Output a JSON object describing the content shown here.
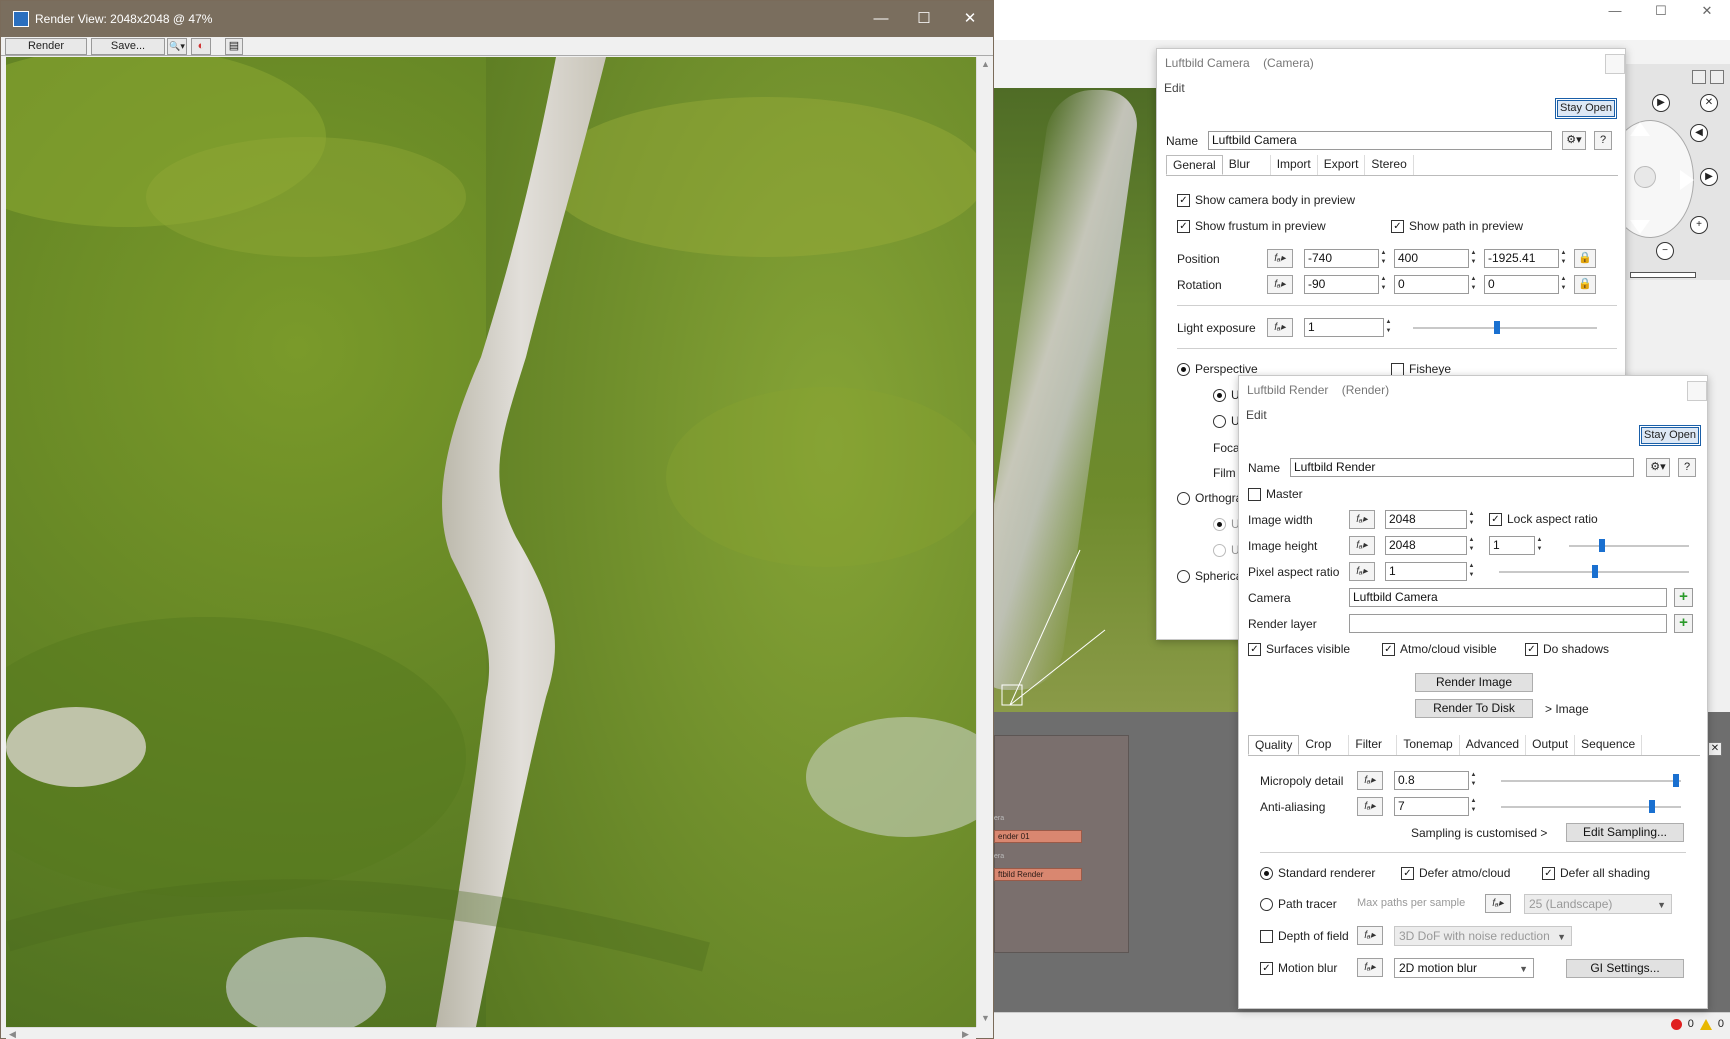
{
  "render_view": {
    "title": "Render View: 2048x2048 @ 47%",
    "toolbar": {
      "render_label": "Render",
      "save_label": "Save...",
      "zoom_glyph": "🔍▾",
      "color_glyph": "◐",
      "doc_glyph": "▤"
    }
  },
  "window_controls": {
    "minimize": "—",
    "maximize": "☐",
    "close": "✕"
  },
  "camera_dialog": {
    "title": "Luftbild Camera",
    "type": "(Camera)",
    "menu_edit": "Edit",
    "stay_open": "Stay Open",
    "name_label": "Name",
    "name_value": "Luftbild Camera",
    "help": "?",
    "tabs": [
      "General",
      "Blur",
      "Import",
      "Export",
      "Stereo"
    ],
    "show_body": "Show camera body in preview",
    "show_frustum": "Show frustum in preview",
    "show_path": "Show path in preview",
    "position_label": "Position",
    "position": [
      "-740",
      "400",
      "-1925.41"
    ],
    "rotation_label": "Rotation",
    "rotation": [
      "-90",
      "0",
      "0"
    ],
    "light_exposure_label": "Light exposure",
    "light_exposure": "1",
    "perspective": "Perspective",
    "fisheye": "Fisheye",
    "sub_u1": "U",
    "sub_u2": "U",
    "foca": "Foca",
    "film": "Film",
    "orthographic": "Orthogra",
    "ortho_u1": "U",
    "ortho_u2": "U",
    "spherical": "Spherica"
  },
  "render_dialog": {
    "title": "Luftbild Render",
    "type": "(Render)",
    "menu_edit": "Edit",
    "stay_open": "Stay Open",
    "name_label": "Name",
    "name_value": "Luftbild Render",
    "help": "?",
    "master": "Master",
    "image_width_label": "Image width",
    "image_width": "2048",
    "lock_aspect": "Lock aspect ratio",
    "image_height_label": "Image height",
    "image_height": "2048",
    "aspect_value": "1",
    "pixel_aspect_label": "Pixel aspect ratio",
    "pixel_aspect": "1",
    "camera_label": "Camera",
    "camera_value": "Luftbild Camera",
    "render_layer_label": "Render layer",
    "render_layer_value": "",
    "surfaces_visible": "Surfaces visible",
    "atmo_visible": "Atmo/cloud visible",
    "do_shadows": "Do shadows",
    "render_image": "Render Image",
    "render_to_disk": "Render To Disk",
    "image_link": ">  Image",
    "tabs": [
      "Quality",
      "Crop",
      "Filter",
      "Tonemap",
      "Advanced",
      "Output",
      "Sequence"
    ],
    "micropoly_label": "Micropoly detail",
    "micropoly": "0.8",
    "antialias_label": "Anti-aliasing",
    "antialias": "7",
    "sampling_text": "Sampling is customised  >",
    "edit_sampling": "Edit Sampling...",
    "standard_renderer": "Standard renderer",
    "defer_atmo": "Defer atmo/cloud",
    "defer_shading": "Defer all shading",
    "path_tracer": "Path tracer",
    "max_paths": "Max paths per sample",
    "max_paths_value": "25 (Landscape)",
    "dof_label": "Depth of field",
    "dof_value": "3D DoF with noise reduction",
    "motion_blur_label": "Motion blur",
    "motion_blur_value": "2D motion blur",
    "gi_settings": "GI Settings..."
  },
  "node_graph": {
    "node1_top": "era",
    "node1_label": "ender 01",
    "node2_top": "era",
    "node2_label": "ftbild Render"
  },
  "status_bar": {
    "errors": "0",
    "warnings": "0"
  },
  "colors": {
    "accent": "#1a70d0",
    "titlebar": "#7a6e5e",
    "grass": "#6a8a2a",
    "node": "#d98770"
  }
}
